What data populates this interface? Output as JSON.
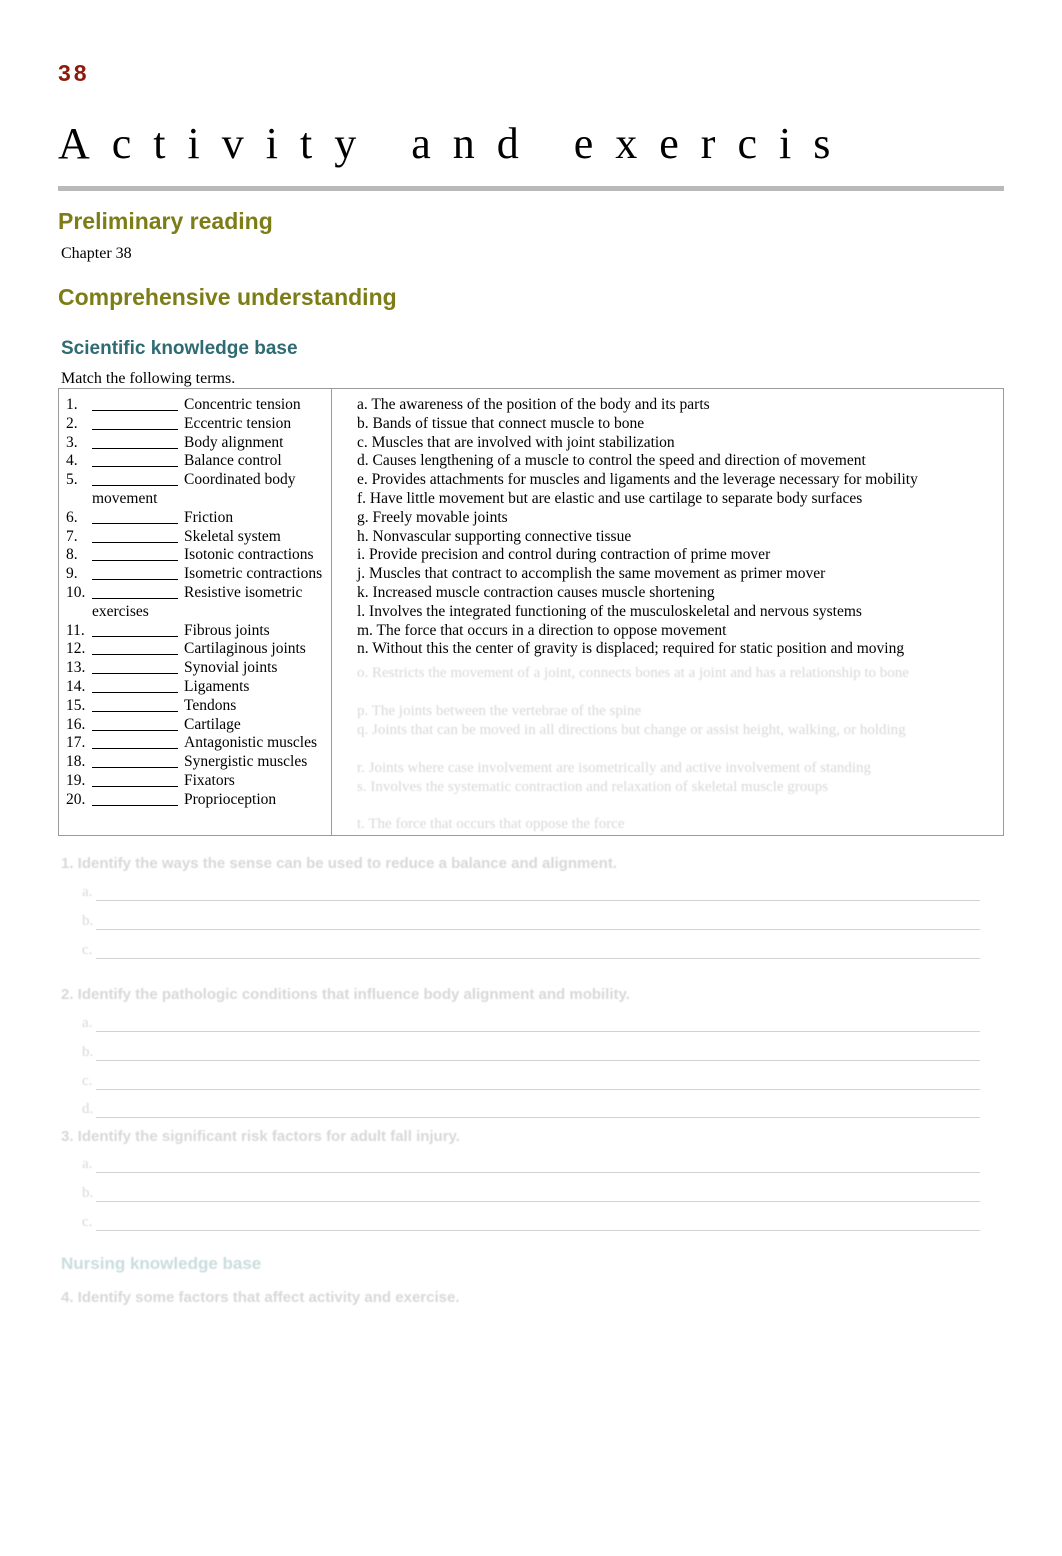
{
  "header": {
    "chapter_number": "38",
    "chapter_title": "Activity and exercis"
  },
  "sections": {
    "preliminary_reading_heading": "Preliminary reading",
    "preliminary_reading_text": "Chapter 38",
    "comprehensive_understanding_heading": "Comprehensive understanding",
    "scientific_knowledge_base_heading": "Scientific knowledge base",
    "match_instruction": "Match the following terms."
  },
  "matching": {
    "terms": [
      {
        "num": "1.",
        "label": "Concentric tension"
      },
      {
        "num": "2.",
        "label": "Eccentric tension"
      },
      {
        "num": "3.",
        "label": "Body alignment"
      },
      {
        "num": "4.",
        "label": "Balance control"
      },
      {
        "num": "5.",
        "label": "Coordinated body",
        "cont": "movement"
      },
      {
        "num": "6.",
        "label": "Friction"
      },
      {
        "num": "7.",
        "label": "Skeletal system"
      },
      {
        "num": "8.",
        "label": "Isotonic contractions"
      },
      {
        "num": "9.",
        "label": "Isometric contractions"
      },
      {
        "num": "10.",
        "label": "Resistive isometric",
        "cont": "exercises"
      },
      {
        "num": "11.",
        "label": "Fibrous joints"
      },
      {
        "num": "12.",
        "label": "Cartilaginous joints"
      },
      {
        "num": "13.",
        "label": "Synovial joints"
      },
      {
        "num": "14.",
        "label": "Ligaments"
      },
      {
        "num": "15.",
        "label": "Tendons"
      },
      {
        "num": "16.",
        "label": "Cartilage"
      },
      {
        "num": "17.",
        "label": "Antagonistic muscles"
      },
      {
        "num": "18.",
        "label": "Synergistic muscles"
      },
      {
        "num": "19.",
        "label": "Fixators"
      },
      {
        "num": "20.",
        "label": "Proprioception"
      }
    ],
    "definitions": [
      "a. The awareness of the position of the body and its parts",
      "b. Bands of tissue that connect muscle to bone",
      "c. Muscles that are involved with joint stabilization",
      "d. Causes lengthening of a muscle to control the speed and direction of movement",
      "e. Provides attachments for muscles and ligaments and the leverage necessary for mobility",
      "f. Have little movement but are elastic and use cartilage to separate body surfaces",
      "g. Freely movable joints",
      "h. Nonvascular supporting connective tissue",
      "i. Provide precision and control during contraction of prime mover",
      "j. Muscles that contract to accomplish the same movement as primer mover",
      "k. Increased muscle contraction causes muscle shortening",
      "l. Involves the integrated functioning of the musculoskeletal and nervous systems",
      "m. The force that occurs in a direction to oppose movement",
      "n. Without this the center of gravity is displaced; required for static position and moving"
    ],
    "faded_definitions": [
      "o. Restricts the movement of a joint, connects bones at a joint and has a relationship to bone",
      "p. The joints between the vertebrae of the spine",
      "q. Joints that can be moved in all directions but change or assist height, walking, or holding",
      "r. Joints where case involvement are isometrically and active involvement of standing",
      "s. Involves the systematic contraction and relaxation of skeletal muscle groups",
      "t. The force that occurs that oppose the force"
    ]
  },
  "faded_questions": [
    {
      "text": "1. Identify the ways the sense can be used to reduce a balance and alignment.",
      "items": [
        "a.",
        "b.",
        "c."
      ]
    },
    {
      "text": "2. Identify the pathologic conditions that influence body alignment and mobility.",
      "items": [
        "a.",
        "b.",
        "c.",
        "d."
      ]
    },
    {
      "text": "3. Identify the significant risk factors for adult fall injury.",
      "items": [
        "a.",
        "b.",
        "c."
      ]
    }
  ],
  "faded_footer": {
    "heading": "Nursing knowledge base",
    "question": "4. Identify some factors that affect activity and exercise."
  }
}
